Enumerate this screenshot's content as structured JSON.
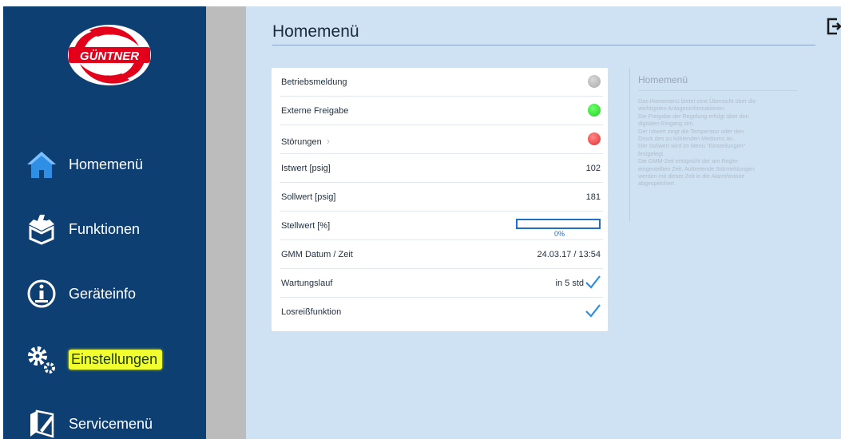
{
  "brand": {
    "logo_text": "GÜNTNER",
    "accent": "#0e3f73",
    "logo_red": "#e2001a"
  },
  "sidebar": {
    "items": [
      {
        "label": "Homemenü",
        "icon": "home-icon"
      },
      {
        "label": "Funktionen",
        "icon": "functions-icon"
      },
      {
        "label": "Geräteinfo",
        "icon": "info-icon"
      },
      {
        "label": "Einstellungen",
        "icon": "gears-icon",
        "highlighted": true
      },
      {
        "label": "Servicemenü",
        "icon": "service-icon"
      }
    ]
  },
  "page": {
    "title": "Homemenü",
    "logout_icon": "logout-icon"
  },
  "rows": [
    {
      "label": "Betriebsmeldung",
      "status_color": "#b3b3b3"
    },
    {
      "label": "Externe Freigabe",
      "status_color": "#2edb2e"
    },
    {
      "label": "Störungen",
      "status_color": "#ee4040",
      "chevron": "›"
    },
    {
      "label": "Istwert [psig]",
      "value": "102"
    },
    {
      "label": "Sollwert [psig]",
      "value": "181"
    },
    {
      "label": "Stellwert [%]",
      "progress": 0,
      "progress_text": "0%"
    },
    {
      "label": "GMM Datum / Zeit",
      "value": "24.03.17 / 13:54"
    },
    {
      "label": "Wartungslauf",
      "value": "in 5 std",
      "checked": true
    },
    {
      "label": "Losreißfunktion",
      "checked": true
    }
  ],
  "help": {
    "title": "Homemenü",
    "lines": [
      "Das Homemenü bietet eine Übersicht über die",
      "wichtigsten Anlageninformationen.",
      "Die Freigabe der Regelung erfolgt über den",
      "digitalen Eingang sim.",
      "Der Istwert zeigt die Temperatur oder den",
      "Druck des zu kühlenden Mediums an.",
      "Der Sollwert wird im Menü \"Einstellungen\"",
      "festgelegt.",
      "Die GMM-Zeit entspricht der am Regler",
      "eingestellten Zeit. Auftretende Störmeldungen",
      "werden mit dieser Zeit in die Alarmhistorie",
      "abgespeichert."
    ]
  }
}
